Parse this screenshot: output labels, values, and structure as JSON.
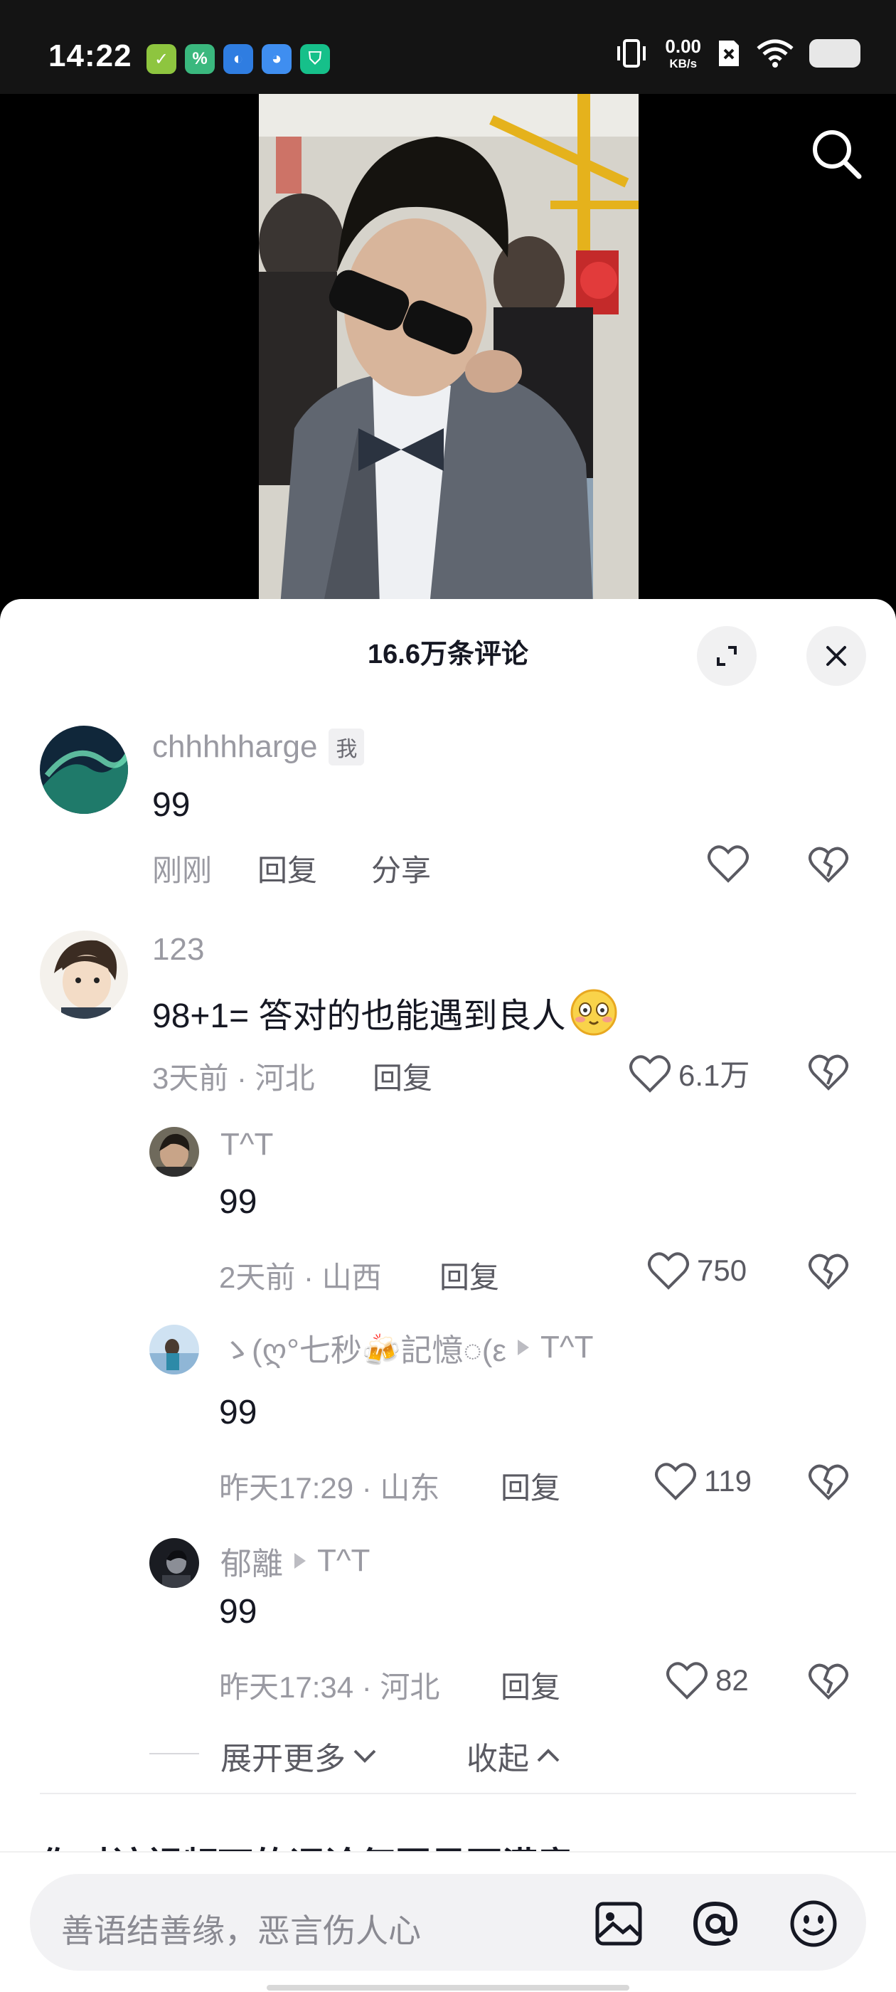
{
  "status_bar": {
    "time": "14:22",
    "apps": [
      {
        "icon": "check-app-icon",
        "color": "#8ec53f",
        "glyph": "✓"
      },
      {
        "icon": "percent-app-icon",
        "color": "#3ab87e",
        "glyph": "%"
      },
      {
        "icon": "moon-app-icon",
        "color": "#2f7de1",
        "glyph": "◐"
      },
      {
        "icon": "swirl-app-icon",
        "color": "#3f8ef0",
        "glyph": "◕"
      },
      {
        "icon": "shield-app-icon",
        "color": "#16c08a",
        "glyph": "⛉"
      }
    ],
    "net_speed_value": "0.00",
    "net_speed_unit": "KB/s"
  },
  "header": {
    "comment_count": "16.6万条评论"
  },
  "comments": [
    {
      "name": "chhhhharge",
      "badge": "我",
      "text": "99",
      "time": "刚刚",
      "reply_label": "回复",
      "share_label": "分享"
    },
    {
      "name": "123",
      "text": "98+1= 答对的也能遇到良人",
      "meta": "3天前 · 河北",
      "reply_label": "回复",
      "likes": "6.1万"
    }
  ],
  "replies": [
    {
      "name": "T^T",
      "text": "99",
      "meta": "2天前 · 山西",
      "reply_label": "回复",
      "likes": "750"
    },
    {
      "name": "ゝ(ღ°七秒🍻記憶◌(ε",
      "reply_to": "T^T",
      "text": "99",
      "meta": "昨天17:29 · 山东",
      "reply_label": "回复",
      "likes": "119"
    },
    {
      "name": "郁離",
      "reply_to": "T^T",
      "text": "99",
      "meta": "昨天17:34 · 河北",
      "reply_label": "回复",
      "likes": "82"
    }
  ],
  "thread_controls": {
    "expand_more": "展开更多",
    "collapse": "收起"
  },
  "survey": {
    "text": "你对该视频下的评论氛围是否满意?"
  },
  "input": {
    "placeholder": "善语结善缘，恶言伤人心"
  }
}
